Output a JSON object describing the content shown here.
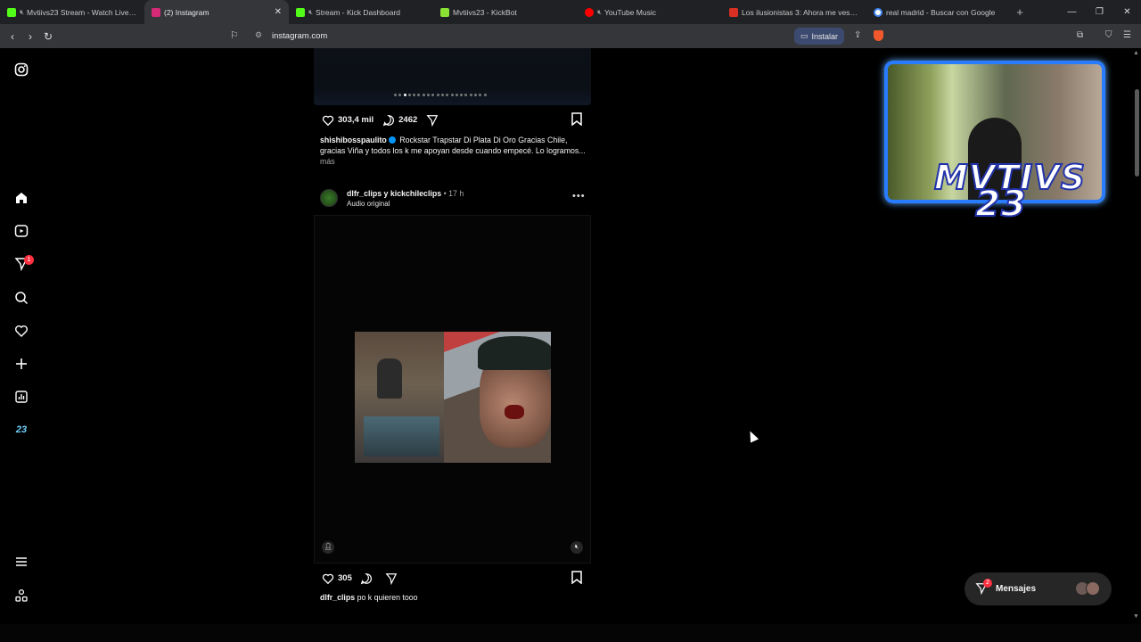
{
  "browser": {
    "tabs": [
      {
        "title": "Mvtiivs23 Stream - Watch Live on",
        "favicon_color": "#53fc18",
        "muted": true,
        "active": false
      },
      {
        "title": "(2) Instagram",
        "favicon_color": "#d62976",
        "muted": false,
        "active": true
      },
      {
        "title": "Stream - Kick Dashboard",
        "favicon_color": "#53fc18",
        "muted": true,
        "active": false
      },
      {
        "title": "Mvtiivs23 - KickBot",
        "favicon_color": "#8ae234",
        "muted": false,
        "active": false
      },
      {
        "title": "YouTube Music",
        "favicon_color": "#ff0000",
        "muted": true,
        "active": false
      },
      {
        "title": "Los ilusionistas 3: Ahora me ves, aho",
        "favicon_color": "#d93025",
        "muted": false,
        "active": false
      },
      {
        "title": "real madrid - Buscar con Google",
        "favicon_color": "#4285f4",
        "muted": false,
        "active": false
      }
    ],
    "url": "instagram.com",
    "install_label": "Instalar"
  },
  "feed": {
    "post1": {
      "likes": "303,4 mil",
      "comments": "2462",
      "username": "shishibosspaulito",
      "caption": "Rockstar Trapstar Di Plata Di Oro Gracias Chile, gracias Viña y todos los k me apoyan desde cuando empecé. Lo logramos...",
      "more": "más",
      "carousel_count": 20,
      "carousel_active": 2
    },
    "post2": {
      "username": "dlfr_clips y kickchileclips",
      "time": "• 17 h",
      "audio": "Audio original",
      "likes": "305",
      "caption_user": "dlfr_clips",
      "caption": "po k quieren tooo"
    }
  },
  "overlay": {
    "line1": "MVTIVS",
    "line2": "23"
  },
  "left_nav": {
    "notification_badge": "1",
    "custom_label": "23"
  },
  "messages": {
    "label": "Mensajes",
    "badge": "2"
  },
  "colors": {
    "background": "#000000",
    "accent_blue": "#0095f6",
    "badge_red": "#ff3040"
  }
}
